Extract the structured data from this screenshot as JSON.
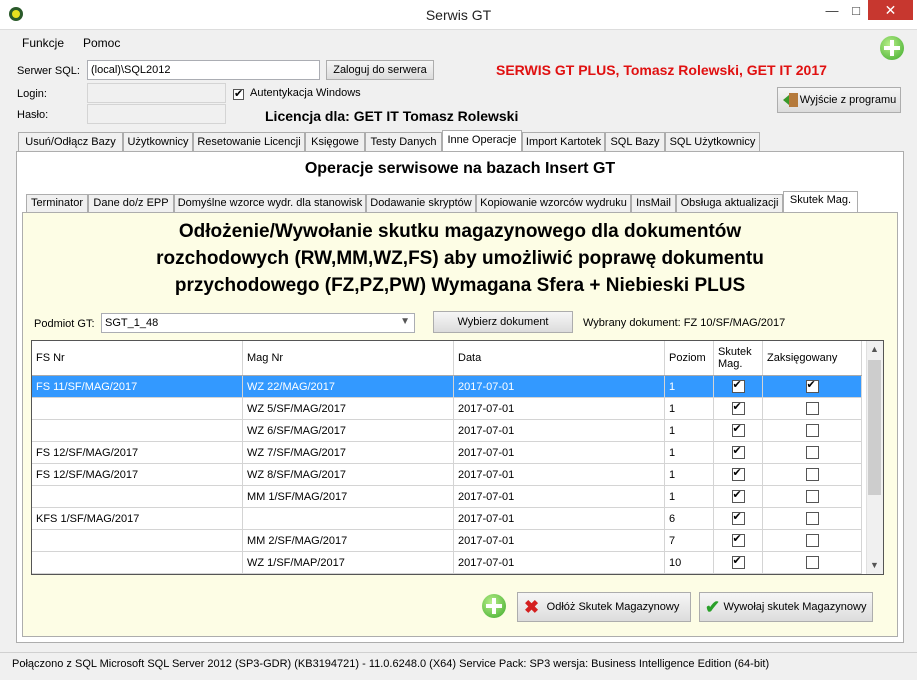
{
  "window": {
    "title": "Serwis GT"
  },
  "menu": {
    "items": [
      "Funkcje",
      "Pomoc"
    ]
  },
  "server": {
    "label": "Serwer SQL:",
    "value": "(local)\\SQL2012",
    "connect_button": "Zaloguj do serwera",
    "login_label": "Login:",
    "password_label": "Hasło:",
    "windows_auth_label": "Autentykacja Windows",
    "windows_auth_checked": true
  },
  "branding": {
    "header": "SERWIS GT PLUS, Tomasz Rolewski, GET IT 2017",
    "license": "Licencja dla: GET IT Tomasz Rolewski",
    "accent_color": "#e01010"
  },
  "exit_button": "Wyjście z programu",
  "main_tabs": [
    "Usuń/Odłącz Bazy",
    "Użytkownicy",
    "Resetowanie Licencji",
    "Księgowe",
    "Testy Danych",
    "Inne Operacje",
    "Import Kartotek",
    "SQL Bazy",
    "SQL Użytkownicy"
  ],
  "main_tab_active": "Inne Operacje",
  "panel_title": "Operacje serwisowe na bazach Insert GT",
  "sub_tabs": [
    "Terminator",
    "Dane do/z EPP",
    "Domyślne wzorce wydr. dla stanowisk",
    "Dodawanie skryptów",
    "Kopiowanie wzorców wydruku",
    "InsMail",
    "Obsługa aktualizacji",
    "Skutek Mag."
  ],
  "sub_tab_active": "Skutek Mag.",
  "skutek": {
    "headline_lines": [
      "Odłożenie/Wywołanie skutku magazynowego dla dokumentów",
      "rozchodowych (RW,MM,WZ,FS) aby umożliwić poprawę dokumentu",
      "przychodowego (FZ,PZ,PW) Wymagana Sfera + Niebieski PLUS"
    ],
    "podmiot_label": "Podmiot GT:",
    "podmiot_value": "SGT_1_48",
    "select_doc_button": "Wybierz dokument",
    "selected_doc_label": "Wybrany dokument: FZ 10/SF/MAG/2017",
    "columns": [
      "FS Nr",
      "Mag Nr",
      "Data",
      "Poziom",
      "Skutek Mag.",
      "Zaksięgowany"
    ],
    "rows": [
      {
        "fs": "FS 11/SF/MAG/2017",
        "mag": "WZ 22/MAG/2017",
        "data": "2017-07-01",
        "poziom": "1",
        "skutek": true,
        "zaks": true
      },
      {
        "fs": "",
        "mag": "WZ 5/SF/MAG/2017",
        "data": "2017-07-01",
        "poziom": "1",
        "skutek": true,
        "zaks": false
      },
      {
        "fs": "",
        "mag": "WZ 6/SF/MAG/2017",
        "data": "2017-07-01",
        "poziom": "1",
        "skutek": true,
        "zaks": false
      },
      {
        "fs": "FS 12/SF/MAG/2017",
        "mag": "WZ 7/SF/MAG/2017",
        "data": "2017-07-01",
        "poziom": "1",
        "skutek": true,
        "zaks": false
      },
      {
        "fs": "FS 12/SF/MAG/2017",
        "mag": "WZ 8/SF/MAG/2017",
        "data": "2017-07-01",
        "poziom": "1",
        "skutek": true,
        "zaks": false
      },
      {
        "fs": "",
        "mag": "MM 1/SF/MAG/2017",
        "data": "2017-07-01",
        "poziom": "1",
        "skutek": true,
        "zaks": false
      },
      {
        "fs": "KFS 1/SF/MAG/2017",
        "mag": "",
        "data": "2017-07-01",
        "poziom": "6",
        "skutek": true,
        "zaks": false
      },
      {
        "fs": "",
        "mag": "MM 2/SF/MAG/2017",
        "data": "2017-07-01",
        "poziom": "7",
        "skutek": true,
        "zaks": false
      },
      {
        "fs": "",
        "mag": "WZ 1/SF/MAP/2017",
        "data": "2017-07-01",
        "poziom": "10",
        "skutek": true,
        "zaks": false
      }
    ],
    "selected_row_index": 0,
    "odloz_button": "Odłóż Skutek Magazynowy",
    "wywolaj_button": "Wywołaj skutek Magazynowy"
  },
  "status": {
    "text": "Połączono z SQL  Microsoft SQL Server 2012 (SP3-GDR) (KB3194721) - 11.0.6248.0 (X64)   Service Pack: SP3  wersja: Business Intelligence Edition (64-bit)"
  },
  "icons": [
    "app-icon",
    "minimize-icon",
    "maximize-icon",
    "close-icon",
    "add-icon",
    "exit-door-icon",
    "delete-x-icon",
    "check-icon"
  ]
}
